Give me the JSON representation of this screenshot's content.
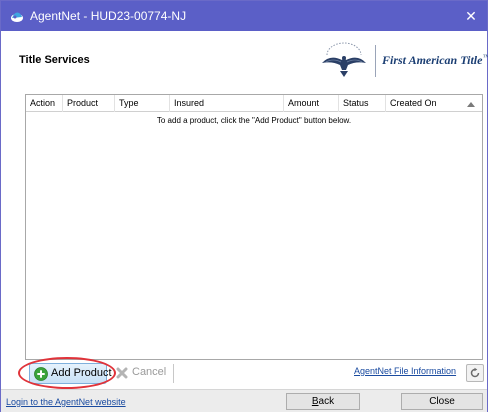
{
  "window": {
    "title": "AgentNet - HUD23-00774-NJ",
    "close_glyph": "✕",
    "accent_color": "#5b5fc7"
  },
  "header": {
    "heading": "Title Services",
    "brand": "First American Title",
    "brand_mark": "™"
  },
  "grid": {
    "columns": [
      "Action",
      "Product",
      "Type",
      "Insured",
      "Amount",
      "Status",
      "Created On"
    ],
    "sorted_column": "Created On",
    "sort_direction": "ascending",
    "rows": [],
    "empty_message": "To add a product, click the \"Add Product\" button below."
  },
  "toolbar": {
    "add_label": "Add Product",
    "add_icon": "plus-circle-icon",
    "add_highlighted": true,
    "highlight_color": "#e0333a",
    "cancel_label": "Cancel",
    "cancel_icon": "x-icon",
    "cancel_enabled": false,
    "file_info_link": "AgentNet File Information",
    "refresh_icon": "refresh-icon"
  },
  "footer": {
    "login_link": "Login to the AgentNet website",
    "back_label": "Back",
    "back_mnemonic": "B",
    "back_rest": "ack",
    "close_label": "Close"
  }
}
